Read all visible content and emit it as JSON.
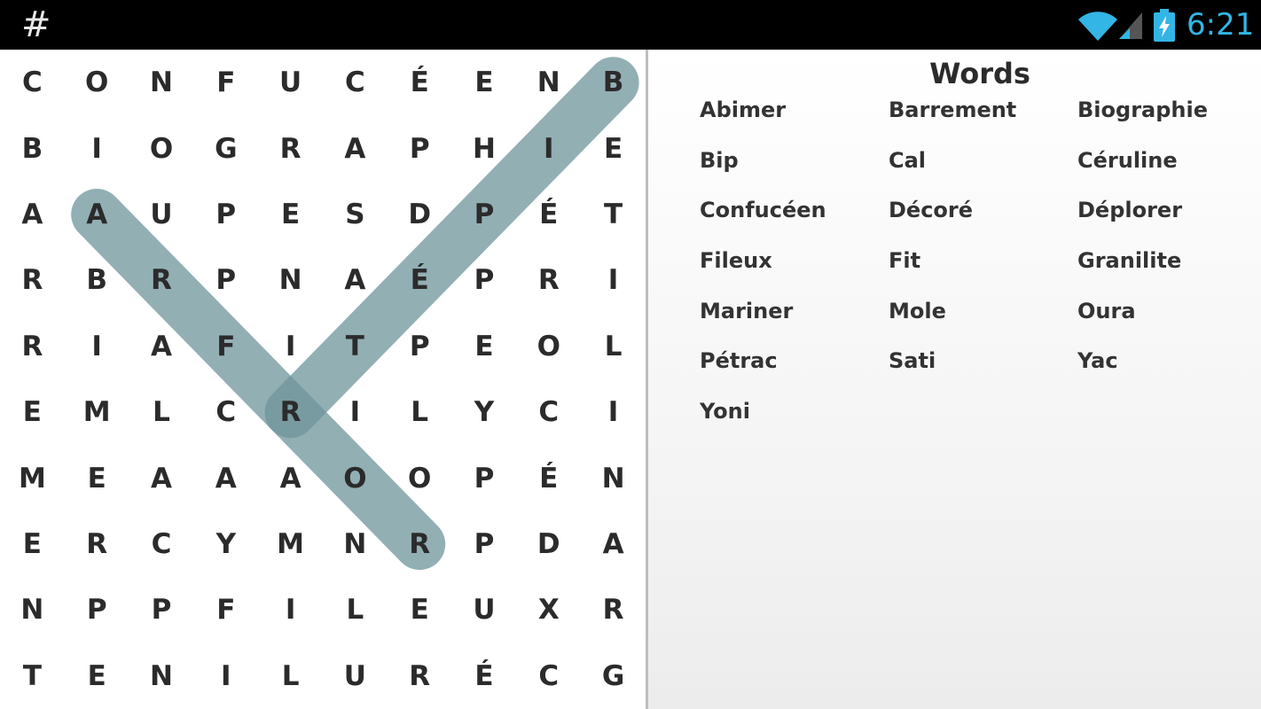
{
  "status_bar": {
    "app_icon": "hash-icon",
    "app_glyph": "#",
    "time": "6:21",
    "accent_color": "#33b5e5",
    "icons": [
      "wifi-icon",
      "signal-icon",
      "battery-icon"
    ]
  },
  "grid": {
    "rows": [
      [
        "C",
        "O",
        "N",
        "F",
        "U",
        "C",
        "É",
        "E",
        "N",
        "B"
      ],
      [
        "B",
        "I",
        "O",
        "G",
        "R",
        "A",
        "P",
        "H",
        "I",
        "E"
      ],
      [
        "A",
        "A",
        "U",
        "P",
        "E",
        "S",
        "D",
        "P",
        "É",
        "T"
      ],
      [
        "R",
        "B",
        "R",
        "P",
        "N",
        "A",
        "É",
        "P",
        "R",
        "I"
      ],
      [
        "R",
        "I",
        "A",
        "F",
        "I",
        "T",
        "P",
        "E",
        "O",
        "L"
      ],
      [
        "E",
        "M",
        "L",
        "C",
        "R",
        "I",
        "L",
        "Y",
        "C",
        "I"
      ],
      [
        "M",
        "E",
        "A",
        "A",
        "A",
        "O",
        "O",
        "P",
        "É",
        "N"
      ],
      [
        "E",
        "R",
        "C",
        "Y",
        "M",
        "N",
        "R",
        "P",
        "D",
        "A"
      ],
      [
        "N",
        "P",
        "P",
        "F",
        "I",
        "L",
        "E",
        "U",
        "X",
        "R"
      ],
      [
        "T",
        "E",
        "N",
        "I",
        "L",
        "U",
        "R",
        "É",
        "C",
        "G"
      ]
    ],
    "highlight_color": "#6d949b",
    "selections": [
      {
        "from": [
          2,
          1
        ],
        "to": [
          7,
          6
        ]
      },
      {
        "from": [
          0,
          9
        ],
        "to": [
          5,
          4
        ]
      }
    ]
  },
  "words_panel": {
    "title": "Words",
    "words": [
      "Abimer",
      "Barrement",
      "Biographie",
      "Bip",
      "Cal",
      "Céruline",
      "Confucéen",
      "Décoré",
      "Déplorer",
      "Fileux",
      "Fit",
      "Granilite",
      "Mariner",
      "Mole",
      "Oura",
      "Pétrac",
      "Sati",
      "Yac",
      "Yoni"
    ]
  }
}
